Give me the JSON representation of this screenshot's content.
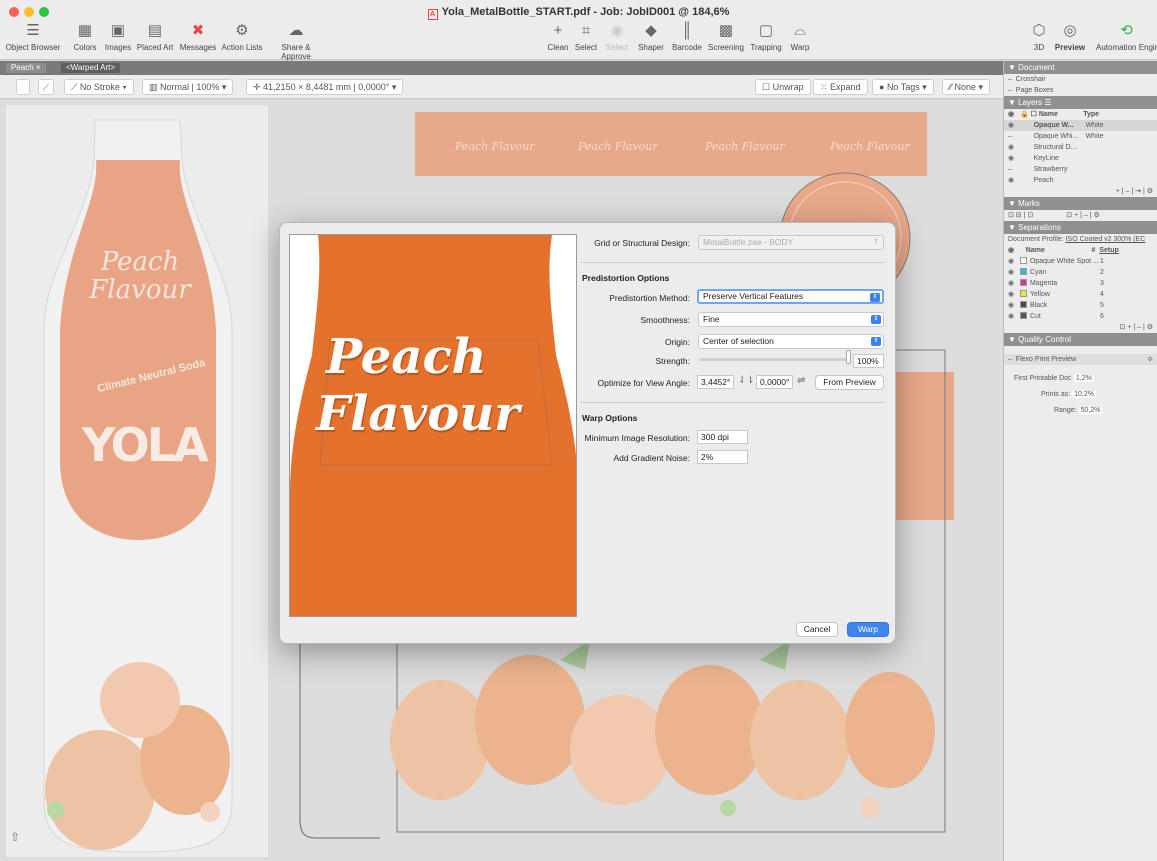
{
  "window": {
    "title": "Yola_MetalBottle_START.pdf - Job: JobID001 @ 184,6%"
  },
  "toolbar": {
    "left": [
      {
        "label": "Object Browser",
        "icon": "object-browser-icon"
      },
      {
        "label": "Colors",
        "icon": "colors-icon"
      },
      {
        "label": "Images",
        "icon": "images-icon"
      },
      {
        "label": "Placed Art",
        "icon": "placed-art-icon"
      },
      {
        "label": "Messages",
        "icon": "messages-icon"
      },
      {
        "label": "Action Lists",
        "icon": "action-lists-icon"
      },
      {
        "label": "Share & Approve",
        "icon": "cloud-icon"
      }
    ],
    "center": [
      {
        "label": "Clean",
        "icon": "clean-icon",
        "enabled": true
      },
      {
        "label": "Select",
        "icon": "select-icon",
        "enabled": true
      },
      {
        "label": "Select",
        "icon": "select-disabled-icon",
        "enabled": false
      },
      {
        "label": "Shaper",
        "icon": "shaper-icon",
        "enabled": true
      },
      {
        "label": "Barcode",
        "icon": "barcode-icon",
        "enabled": true
      },
      {
        "label": "Screening",
        "icon": "screening-icon",
        "enabled": true
      },
      {
        "label": "Trapping",
        "icon": "trapping-icon",
        "enabled": true
      },
      {
        "label": "Warp",
        "icon": "warp-icon",
        "enabled": true
      }
    ],
    "right": [
      {
        "label": "3D",
        "icon": "3d-icon"
      },
      {
        "label": "Preview",
        "icon": "preview-icon"
      },
      {
        "label": "Automation Engine",
        "icon": "automation-engine-icon"
      }
    ]
  },
  "tabs": {
    "active": "Peach",
    "breadcrumb": "<Warped Art>"
  },
  "options_bar": {
    "stroke": "No Stroke",
    "blend": "Normal | 100%",
    "coords": "41,2150 × 8,4481 mm | 0,0000°",
    "unwrap": "Unwrap",
    "expand": "Expand",
    "tags": "No Tags",
    "none": "None"
  },
  "artwork": {
    "bottle_title": "Peach\nFlavour",
    "bottle_climate": "Climate Neutral Soda",
    "bottle_brand": "YOLA",
    "strip_label": "Peach Flavour"
  },
  "dialog": {
    "preview_line1": "Peach",
    "preview_line2": "Flavour",
    "grid_label": "Grid or Structural Design:",
    "grid_value": "MetalBottle.zae - BODY",
    "predistortion_header": "Predistortion Options",
    "method_label": "Predistortion Method:",
    "method_value": "Preserve Vertical Features",
    "smoothness_label": "Smoothness:",
    "smoothness_value": "Fine",
    "origin_label": "Origin:",
    "origin_value": "Center of selection",
    "strength_label": "Strength:",
    "strength_value": "100%",
    "strength_level": 1.0,
    "view_angle_label": "Optimize for View Angle:",
    "view_angle_h": "3,4452°",
    "view_angle_v": "0,0000°",
    "from_preview": "From Preview",
    "warp_header": "Warp Options",
    "min_res_label": "Minimum Image Resolution:",
    "min_res_value": "300 dpi",
    "noise_label": "Add Gradient Noise:",
    "noise_value": "2%",
    "cancel": "Cancel",
    "warp": "Warp"
  },
  "panel": {
    "document_header": "Document",
    "crosshair": "Crosshair",
    "page_boxes": "Page Boxes",
    "layers_header": "Layers",
    "layers_cols": {
      "name": "Name",
      "type": "Type"
    },
    "layers": [
      {
        "name": "Opaque W...",
        "type": "White",
        "selected": true
      },
      {
        "name": "Opaque Whi...",
        "type": "White",
        "selected": false
      },
      {
        "name": "Structural D...",
        "type": "",
        "selected": false
      },
      {
        "name": "KeyLine",
        "type": "",
        "selected": false
      },
      {
        "name": "Strawberry",
        "type": "",
        "selected": false
      },
      {
        "name": "Peach",
        "type": "",
        "selected": false
      }
    ],
    "marks_header": "Marks",
    "separations_header": "Separations",
    "doc_profile_label": "Document Profile:",
    "doc_profile_value": "ISO Coated v2 300% (EC",
    "sep_cols": {
      "name": "Name",
      "num": "#",
      "setup": "Setup"
    },
    "separations": [
      {
        "name": "Opaque White Spot ...",
        "num": "1",
        "color": "#ffffff"
      },
      {
        "name": "Cyan",
        "num": "2",
        "color": "#39b3e6"
      },
      {
        "name": "Magenta",
        "num": "3",
        "color": "#e0338a"
      },
      {
        "name": "Yellow",
        "num": "4",
        "color": "#f4e23a"
      },
      {
        "name": "Black",
        "num": "5",
        "color": "#4a4a4a"
      },
      {
        "name": "Cut",
        "num": "6",
        "color": "#555555"
      }
    ],
    "quality_header": "Quality Control",
    "flexo_label": "Flexo Print Preview",
    "first_dot_label": "First Printable Dot:",
    "first_dot_value": "1,2%",
    "prints_as_label": "Prints as:",
    "prints_as_value": "10,2%",
    "range_label": "Range:",
    "range_value": "50,2%"
  },
  "colors": {
    "accent": "#3d86f0",
    "peach": "#e8a88a",
    "orange": "#e0702a"
  }
}
